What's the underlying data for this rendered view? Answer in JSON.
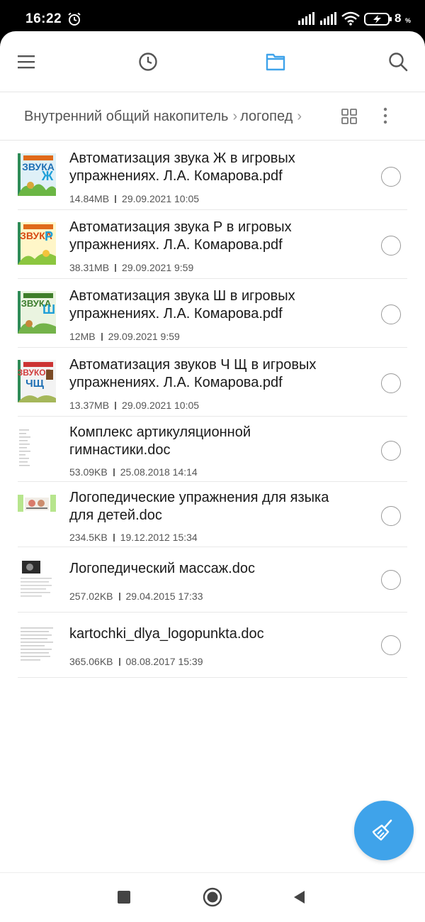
{
  "status_bar": {
    "time": "16:22",
    "battery_level": "8",
    "battery_pct": "%"
  },
  "toolbar": {
    "menu_icon": "hamburger-menu-icon",
    "recent_icon": "clock-icon",
    "files_icon": "folder-icon",
    "search_icon": "search-icon",
    "accent_color": "#3fa3ea"
  },
  "breadcrumb": {
    "root": "Внутренний общий накопитель",
    "folder": "логопед"
  },
  "files": [
    {
      "name_line1": "Автоматизация звука Ж в игровых",
      "name_line2": "упражнениях. Л.А. Комарова.pdf",
      "size": "14.84MB",
      "date": "29.09.2021 10:05",
      "thumb_type": "book-cover",
      "thumb_label": "Ж"
    },
    {
      "name_line1": "Автоматизация звука Р в игровых",
      "name_line2": "упражнениях. Л.А. Комарова.pdf",
      "size": "38.31MB",
      "date": "29.09.2021 9:59",
      "thumb_type": "book-cover",
      "thumb_label": "Р"
    },
    {
      "name_line1": "Автоматизация звука Ш в игровых",
      "name_line2": "упражнениях. Л.А. Комарова.pdf",
      "size": "12MB",
      "date": "29.09.2021 9:59",
      "thumb_type": "book-cover",
      "thumb_label": "Ш"
    },
    {
      "name_line1": "Автоматизация звуков Ч Щ в игровых",
      "name_line2": "упражнениях. Л.А. Комарова.pdf",
      "size": "13.37MB",
      "date": "29.09.2021 10:05",
      "thumb_type": "book-cover",
      "thumb_label": "ЧЩ"
    },
    {
      "name_line1": "Комплекс артикуляционной",
      "name_line2": "гимнастики.doc",
      "size": "53.09KB",
      "date": "25.08.2018 14:14",
      "thumb_type": "doc-page"
    },
    {
      "name_line1": "Логопедические упражнения для языка",
      "name_line2": "для детей.doc",
      "size": "234.5KB",
      "date": "19.12.2012 15:34",
      "thumb_type": "doc-picture"
    },
    {
      "name_line1": "Логопедический массаж.doc",
      "name_line2": "",
      "size": "257.02KB",
      "date": "29.04.2015 17:33",
      "thumb_type": "doc-photo"
    },
    {
      "name_line1": "kartochki_dlya_logopunkta.doc",
      "name_line2": "",
      "size": "365.06KB",
      "date": "08.08.2017 15:39",
      "thumb_type": "doc-page"
    }
  ],
  "fab": {
    "icon": "broom-clean-icon"
  },
  "nav": {
    "recents_icon": "square-recents-icon",
    "home_icon": "circle-home-icon",
    "back_icon": "triangle-back-icon"
  }
}
